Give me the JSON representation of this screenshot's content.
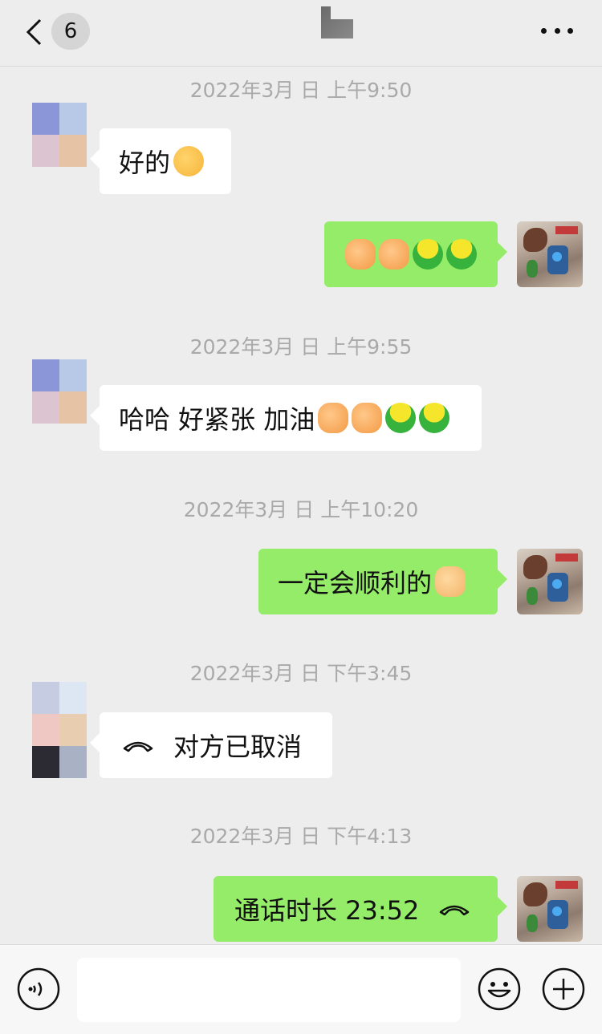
{
  "header": {
    "unread_count": "6",
    "more_icon": "more-horizontal-icon",
    "back_icon": "chevron-left-icon"
  },
  "messages": [
    {
      "type": "timestamp",
      "text": "2022年3月    日 上午9:50"
    },
    {
      "type": "in",
      "text": "好的",
      "emoji": [
        "ok-hand"
      ]
    },
    {
      "type": "out",
      "text": "",
      "emoji": [
        "fist",
        "fist",
        "frog",
        "frog"
      ]
    },
    {
      "type": "timestamp",
      "text": "2022年3月    日 上午9:55"
    },
    {
      "type": "in",
      "text": "哈哈 好紧张 加油",
      "emoji": [
        "fist",
        "fist",
        "frog",
        "frog"
      ]
    },
    {
      "type": "timestamp",
      "text": "2022年3月    日 上午10:20"
    },
    {
      "type": "out",
      "text": "一定会顺利的",
      "emoji": [
        "victory-hand"
      ]
    },
    {
      "type": "timestamp",
      "text": "2022年3月    日 下午3:45"
    },
    {
      "type": "in",
      "text": "对方已取消",
      "icon": "phone-hangup-icon"
    },
    {
      "type": "timestamp",
      "text": "2022年3月    日 下午4:13"
    },
    {
      "type": "out",
      "text": "通话时长 23:52",
      "icon": "phone-hangup-icon"
    }
  ],
  "input": {
    "placeholder": ""
  },
  "colors": {
    "outgoing_bubble": "#95ec69",
    "incoming_bubble": "#ffffff",
    "background": "#ededed",
    "timestamp": "#a9a9a9"
  }
}
